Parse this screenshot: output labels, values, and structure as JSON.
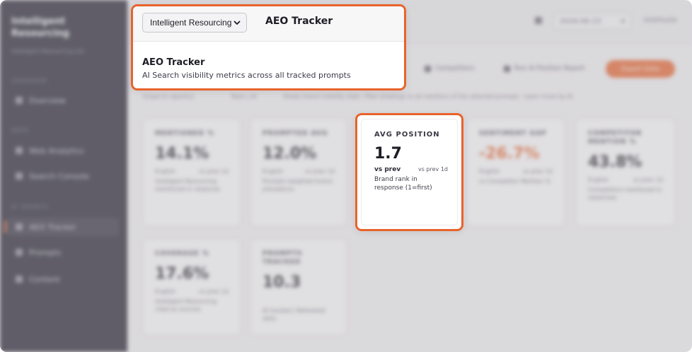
{
  "app": {
    "brand": "Intelligent Resourcing",
    "brand_sub": "Intelligent Resourcing Ltd",
    "topbar": {
      "date": "2026-06-23",
      "user": "Intellisuite"
    }
  },
  "sidebar": {
    "sections": [
      "OVERVIEW",
      "DATA",
      "AI SEARCH"
    ],
    "items": [
      {
        "label": "Overview",
        "icon": "grid-icon"
      },
      {
        "label": "Web Analytics",
        "icon": "chart-icon"
      },
      {
        "label": "Search Console",
        "icon": "search-icon"
      },
      {
        "label": "AEO Tracker",
        "icon": "target-icon",
        "active": true
      },
      {
        "label": "Prompts",
        "icon": "chat-icon"
      },
      {
        "label": "Content",
        "icon": "document-icon"
      }
    ]
  },
  "toolbar": {
    "competitors": "Competitors",
    "run_model": "Run AI Position Report",
    "primary": "Export Data"
  },
  "filter": {
    "label": "Scope to report(s)",
    "value": "Team | AI",
    "note": "Shows brand visibility stats. Filter drawings to all mentions of the selected prompts · Learn more by AI"
  },
  "header": {
    "select_value": "Intelligent Resourcing",
    "title": "AEO Tracker",
    "page_title": "AEO Tracker",
    "page_subtitle": "AI Search visibility metrics across all tracked prompts"
  },
  "cards": [
    {
      "label": "MENTIONED %",
      "value": "14.1%",
      "vs": "English",
      "prev": "vs prev 1d",
      "desc": "Intelligent Resourcing mentioned in response"
    },
    {
      "label": "PROMPTED AVG",
      "value": "12.0%",
      "vs": "English",
      "prev": "vs prev 1d",
      "desc": "Prompts weighted brand prevalence"
    },
    {
      "label": "AVG POSITION",
      "value": "1.7",
      "vs": "vs prev",
      "prev": "vs prev 1d",
      "desc": "Brand rank in response (1=first)",
      "highlighted": true
    },
    {
      "label": "SENTIMENT GAP",
      "value": "-26.7%",
      "vs": "English",
      "prev": "vs prev 1d",
      "desc": "vs Competitor Mention %",
      "negative": true
    },
    {
      "label": "COMPETITOR MENTION %",
      "value": "43.8%",
      "vs": "English",
      "prev": "vs prev 1d",
      "desc": "Competitors mentioned in responses"
    },
    {
      "label": "COVERAGE %",
      "value": "17.6%",
      "vs": "English",
      "prev": "vs prev 1d",
      "desc": "Intelligent Resourcing cited as sources"
    },
    {
      "label": "PROMPTS TRACKED",
      "value": "10.3",
      "vs": "",
      "prev": "",
      "desc": "AI tracked | Refreshed daily"
    }
  ],
  "colors": {
    "accent": "#e8632b",
    "sidebar_bg": "#1f1d2b",
    "text_dark": "#1e1d26"
  }
}
